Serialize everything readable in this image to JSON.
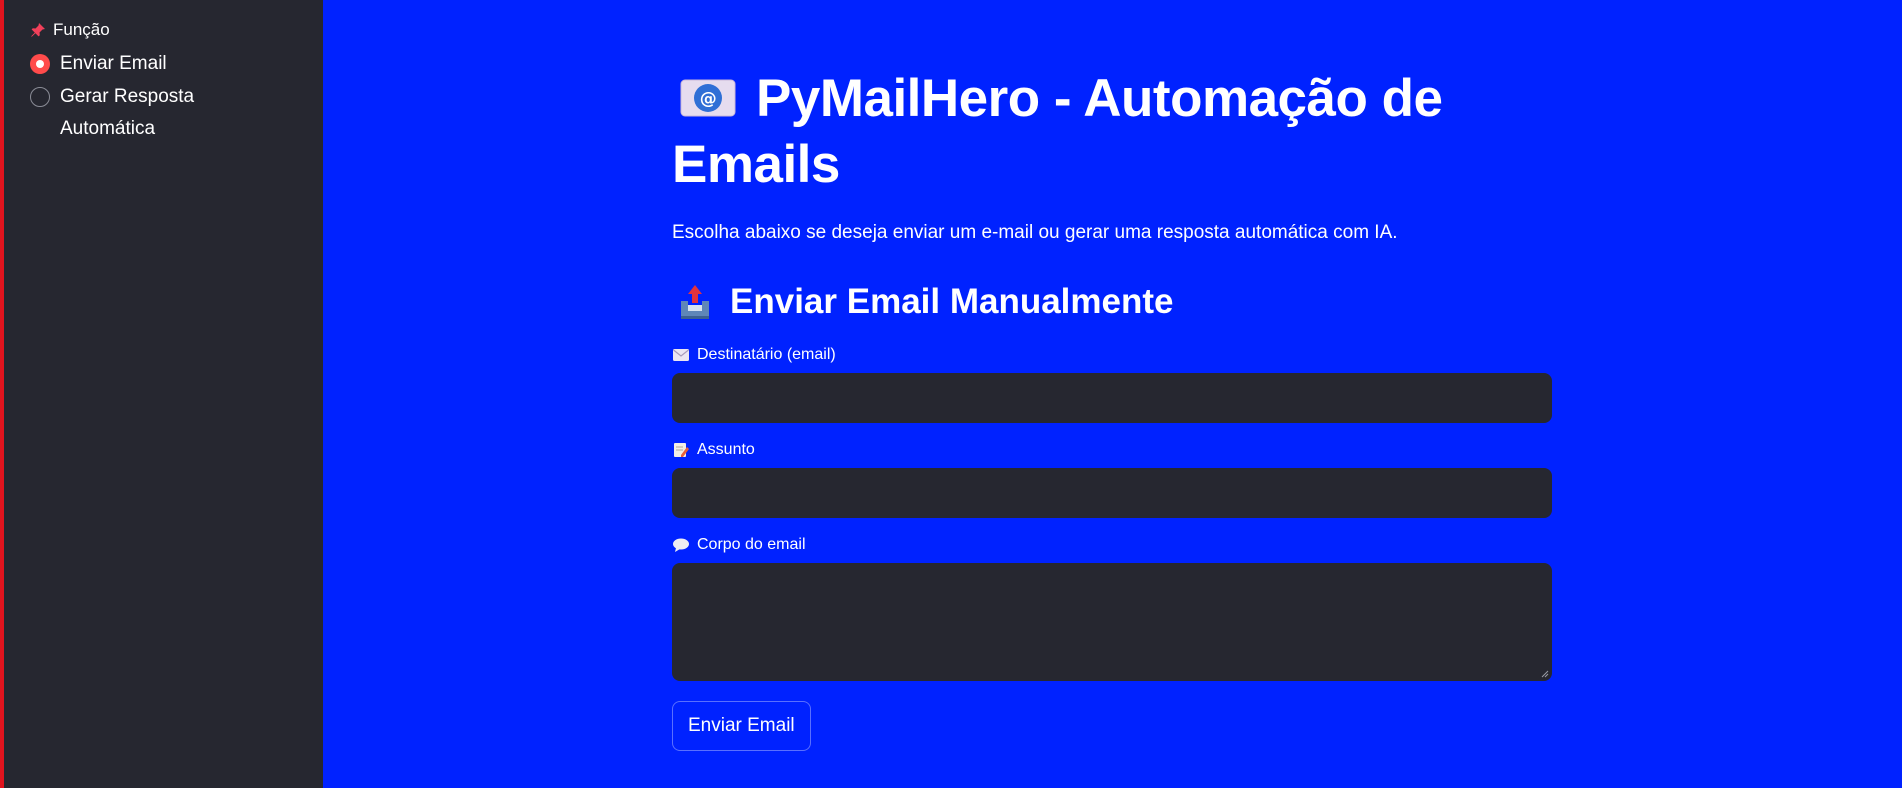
{
  "sidebar": {
    "title_icon": "pushpin-icon",
    "title": "Função",
    "options": [
      {
        "label": "Enviar Email",
        "selected": true
      },
      {
        "label": "Gerar Resposta Automática",
        "selected": false
      }
    ]
  },
  "main": {
    "title_icon": "envelope-at-icon",
    "title": "PyMailHero - Automação de Emails",
    "intro": "Escolha abaixo se deseja enviar um e-mail ou gerar uma resposta automática com IA.",
    "section": {
      "icon": "outbox-tray-icon",
      "heading": "Enviar Email Manualmente"
    },
    "fields": {
      "recipient": {
        "icon": "envelope-icon",
        "label": "Destinatário (email)",
        "value": ""
      },
      "subject": {
        "icon": "memo-icon",
        "label": "Assunto",
        "value": ""
      },
      "body": {
        "icon": "speech-bubble-icon",
        "label": "Corpo do email",
        "value": ""
      }
    },
    "submit_label": "Enviar Email"
  },
  "colors": {
    "background": "#0022ff",
    "sidebar": "#262730",
    "input": "#262730",
    "accent": "#ff4b4b",
    "edge": "#e0141e"
  }
}
